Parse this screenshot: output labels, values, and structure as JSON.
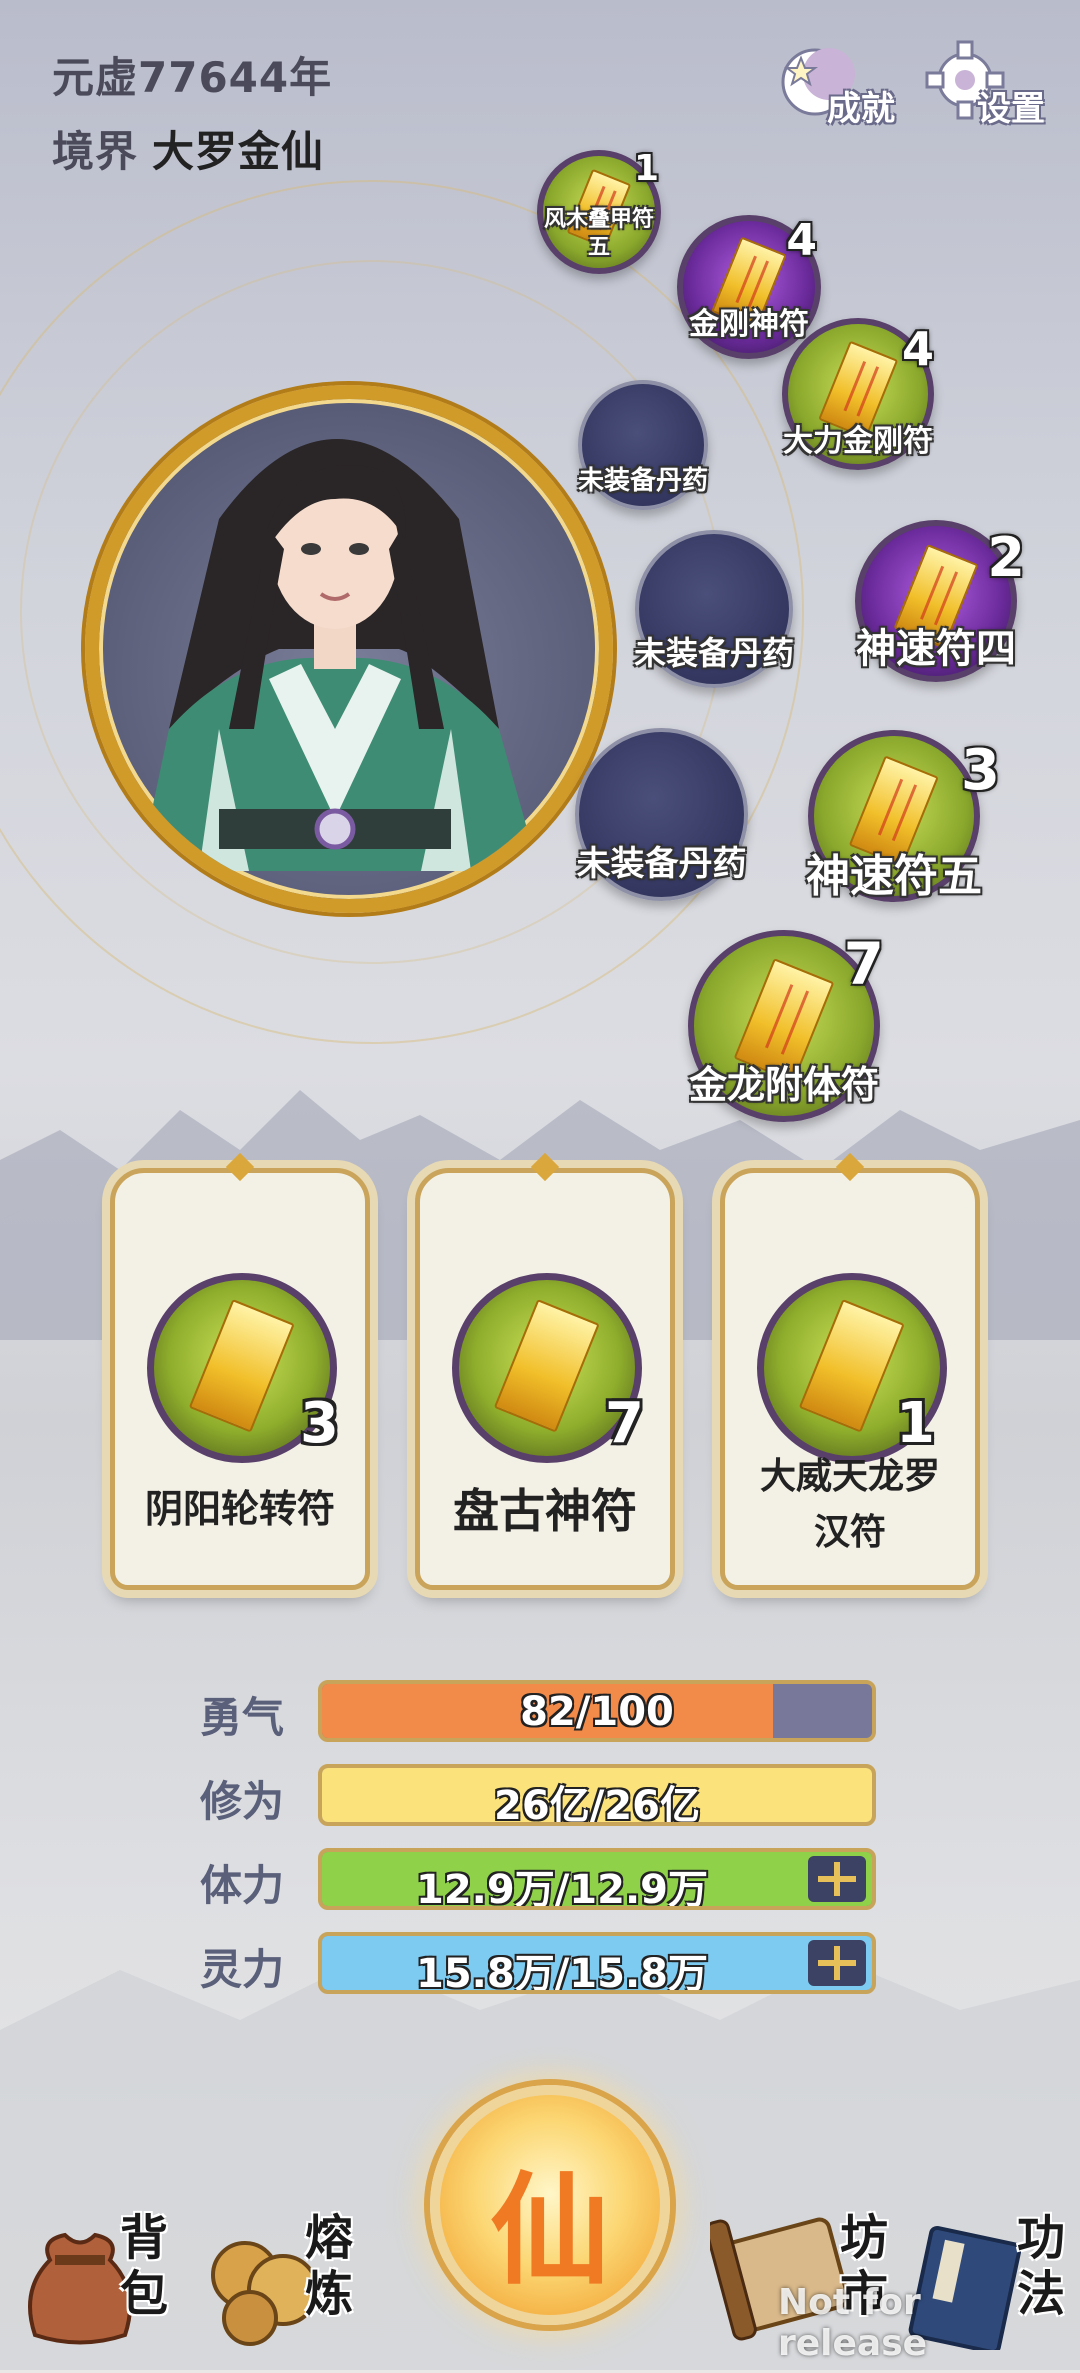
{
  "header": {
    "year_text": "元虚77644年",
    "realm_label": "境界",
    "realm_value": "大罗金仙"
  },
  "top_buttons": {
    "achievements_label": "成就",
    "achievements_icon": "moon-star-icon",
    "settings_label": "设置",
    "settings_icon": "gear-icon"
  },
  "equipment_slots": [
    {
      "name": "风木叠甲符五",
      "level": "1",
      "state": "filled"
    },
    {
      "name": "金刚神符",
      "level": "4",
      "state": "filled"
    },
    {
      "name": "大力金刚符",
      "level": "4",
      "state": "filled"
    },
    {
      "name": "未装备丹药",
      "level": "",
      "state": "empty"
    },
    {
      "name": "未装备丹药",
      "level": "",
      "state": "empty"
    },
    {
      "name": "神速符四",
      "level": "2",
      "state": "filled"
    },
    {
      "name": "未装备丹药",
      "level": "",
      "state": "empty"
    },
    {
      "name": "神速符五",
      "level": "3",
      "state": "filled"
    },
    {
      "name": "金龙附体符",
      "level": "7",
      "state": "filled"
    }
  ],
  "slot_name_lines": {
    "line1": "风木叠甲符",
    "line2": "五"
  },
  "cards": [
    {
      "name": "阴阳轮转符",
      "level": "3"
    },
    {
      "name": "盘古神符",
      "level": "7"
    },
    {
      "name_line1": "大威天龙罗",
      "name_line2": "汉符",
      "level": "1"
    }
  ],
  "stats": [
    {
      "label": "勇气",
      "value": "82/100",
      "fraction": 0.82,
      "color": "#f28a4a"
    },
    {
      "label": "修为",
      "value": "26亿/26亿",
      "fraction": 1.0,
      "color": "#fbe27a"
    },
    {
      "label": "体力",
      "value": "12.9万/12.9万",
      "fraction": 1.0,
      "color": "#8fd24a",
      "has_plus": true
    },
    {
      "label": "灵力",
      "value": "15.8万/15.8万",
      "fraction": 1.0,
      "color": "#7ecbf2",
      "has_plus": true
    }
  ],
  "center_button": {
    "label": "仙"
  },
  "bottom_nav": [
    {
      "label_line1": "背",
      "label_line2": "包",
      "icon": "bag-icon"
    },
    {
      "label_line1": "熔",
      "label_line2": "炼",
      "icon": "cauldron-icon"
    },
    {
      "label_line1": "坊",
      "label_line2": "市",
      "icon": "scroll-icon"
    },
    {
      "label_line1": "功",
      "label_line2": "法",
      "icon": "book-icon"
    }
  ],
  "watermark": "Not for release"
}
